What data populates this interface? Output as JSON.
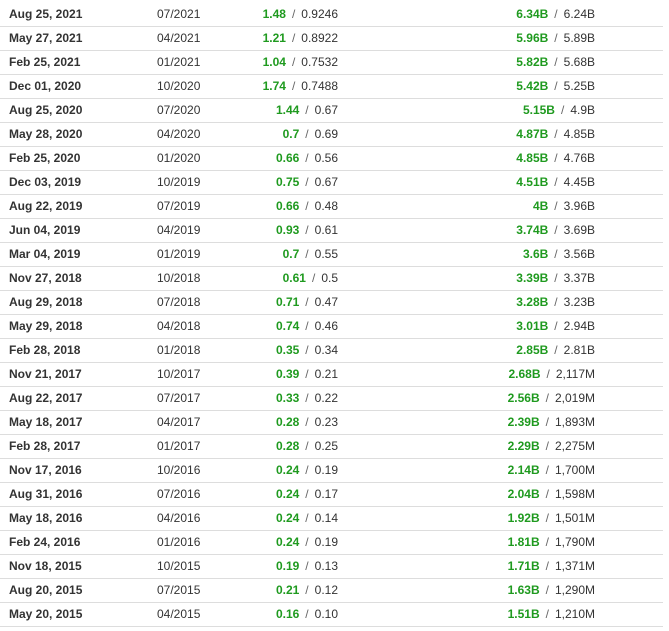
{
  "rows": [
    {
      "date": "Aug 25, 2021",
      "period": "07/2021",
      "eps_actual": "1.48",
      "eps_forecast": "0.9246",
      "rev_actual": "6.34B",
      "rev_forecast": "6.24B"
    },
    {
      "date": "May 27, 2021",
      "period": "04/2021",
      "eps_actual": "1.21",
      "eps_forecast": "0.8922",
      "rev_actual": "5.96B",
      "rev_forecast": "5.89B"
    },
    {
      "date": "Feb 25, 2021",
      "period": "01/2021",
      "eps_actual": "1.04",
      "eps_forecast": "0.7532",
      "rev_actual": "5.82B",
      "rev_forecast": "5.68B"
    },
    {
      "date": "Dec 01, 2020",
      "period": "10/2020",
      "eps_actual": "1.74",
      "eps_forecast": "0.7488",
      "rev_actual": "5.42B",
      "rev_forecast": "5.25B"
    },
    {
      "date": "Aug 25, 2020",
      "period": "07/2020",
      "eps_actual": "1.44",
      "eps_forecast": "0.67",
      "rev_actual": "5.15B",
      "rev_forecast": "4.9B"
    },
    {
      "date": "May 28, 2020",
      "period": "04/2020",
      "eps_actual": "0.7",
      "eps_forecast": "0.69",
      "rev_actual": "4.87B",
      "rev_forecast": "4.85B"
    },
    {
      "date": "Feb 25, 2020",
      "period": "01/2020",
      "eps_actual": "0.66",
      "eps_forecast": "0.56",
      "rev_actual": "4.85B",
      "rev_forecast": "4.76B"
    },
    {
      "date": "Dec 03, 2019",
      "period": "10/2019",
      "eps_actual": "0.75",
      "eps_forecast": "0.67",
      "rev_actual": "4.51B",
      "rev_forecast": "4.45B"
    },
    {
      "date": "Aug 22, 2019",
      "period": "07/2019",
      "eps_actual": "0.66",
      "eps_forecast": "0.48",
      "rev_actual": "4B",
      "rev_forecast": "3.96B"
    },
    {
      "date": "Jun 04, 2019",
      "period": "04/2019",
      "eps_actual": "0.93",
      "eps_forecast": "0.61",
      "rev_actual": "3.74B",
      "rev_forecast": "3.69B"
    },
    {
      "date": "Mar 04, 2019",
      "period": "01/2019",
      "eps_actual": "0.7",
      "eps_forecast": "0.55",
      "rev_actual": "3.6B",
      "rev_forecast": "3.56B"
    },
    {
      "date": "Nov 27, 2018",
      "period": "10/2018",
      "eps_actual": "0.61",
      "eps_forecast": "0.5",
      "rev_actual": "3.39B",
      "rev_forecast": "3.37B"
    },
    {
      "date": "Aug 29, 2018",
      "period": "07/2018",
      "eps_actual": "0.71",
      "eps_forecast": "0.47",
      "rev_actual": "3.28B",
      "rev_forecast": "3.23B"
    },
    {
      "date": "May 29, 2018",
      "period": "04/2018",
      "eps_actual": "0.74",
      "eps_forecast": "0.46",
      "rev_actual": "3.01B",
      "rev_forecast": "2.94B"
    },
    {
      "date": "Feb 28, 2018",
      "period": "01/2018",
      "eps_actual": "0.35",
      "eps_forecast": "0.34",
      "rev_actual": "2.85B",
      "rev_forecast": "2.81B"
    },
    {
      "date": "Nov 21, 2017",
      "period": "10/2017",
      "eps_actual": "0.39",
      "eps_forecast": "0.21",
      "rev_actual": "2.68B",
      "rev_forecast": "2,117M"
    },
    {
      "date": "Aug 22, 2017",
      "period": "07/2017",
      "eps_actual": "0.33",
      "eps_forecast": "0.22",
      "rev_actual": "2.56B",
      "rev_forecast": "2,019M"
    },
    {
      "date": "May 18, 2017",
      "period": "04/2017",
      "eps_actual": "0.28",
      "eps_forecast": "0.23",
      "rev_actual": "2.39B",
      "rev_forecast": "1,893M"
    },
    {
      "date": "Feb 28, 2017",
      "period": "01/2017",
      "eps_actual": "0.28",
      "eps_forecast": "0.25",
      "rev_actual": "2.29B",
      "rev_forecast": "2,275M"
    },
    {
      "date": "Nov 17, 2016",
      "period": "10/2016",
      "eps_actual": "0.24",
      "eps_forecast": "0.19",
      "rev_actual": "2.14B",
      "rev_forecast": "1,700M"
    },
    {
      "date": "Aug 31, 2016",
      "period": "07/2016",
      "eps_actual": "0.24",
      "eps_forecast": "0.17",
      "rev_actual": "2.04B",
      "rev_forecast": "1,598M"
    },
    {
      "date": "May 18, 2016",
      "period": "04/2016",
      "eps_actual": "0.24",
      "eps_forecast": "0.14",
      "rev_actual": "1.92B",
      "rev_forecast": "1,501M"
    },
    {
      "date": "Feb 24, 2016",
      "period": "01/2016",
      "eps_actual": "0.24",
      "eps_forecast": "0.19",
      "rev_actual": "1.81B",
      "rev_forecast": "1,790M"
    },
    {
      "date": "Nov 18, 2015",
      "period": "10/2015",
      "eps_actual": "0.19",
      "eps_forecast": "0.13",
      "rev_actual": "1.71B",
      "rev_forecast": "1,371M"
    },
    {
      "date": "Aug 20, 2015",
      "period": "07/2015",
      "eps_actual": "0.21",
      "eps_forecast": "0.12",
      "rev_actual": "1.63B",
      "rev_forecast": "1,290M"
    },
    {
      "date": "May 20, 2015",
      "period": "04/2015",
      "eps_actual": "0.16",
      "eps_forecast": "0.10",
      "rev_actual": "1.51B",
      "rev_forecast": "1,210M"
    }
  ],
  "separator": "/",
  "colors": {
    "actual": "#1f9a1f",
    "text": "#333333",
    "divider": "#dddddd"
  }
}
